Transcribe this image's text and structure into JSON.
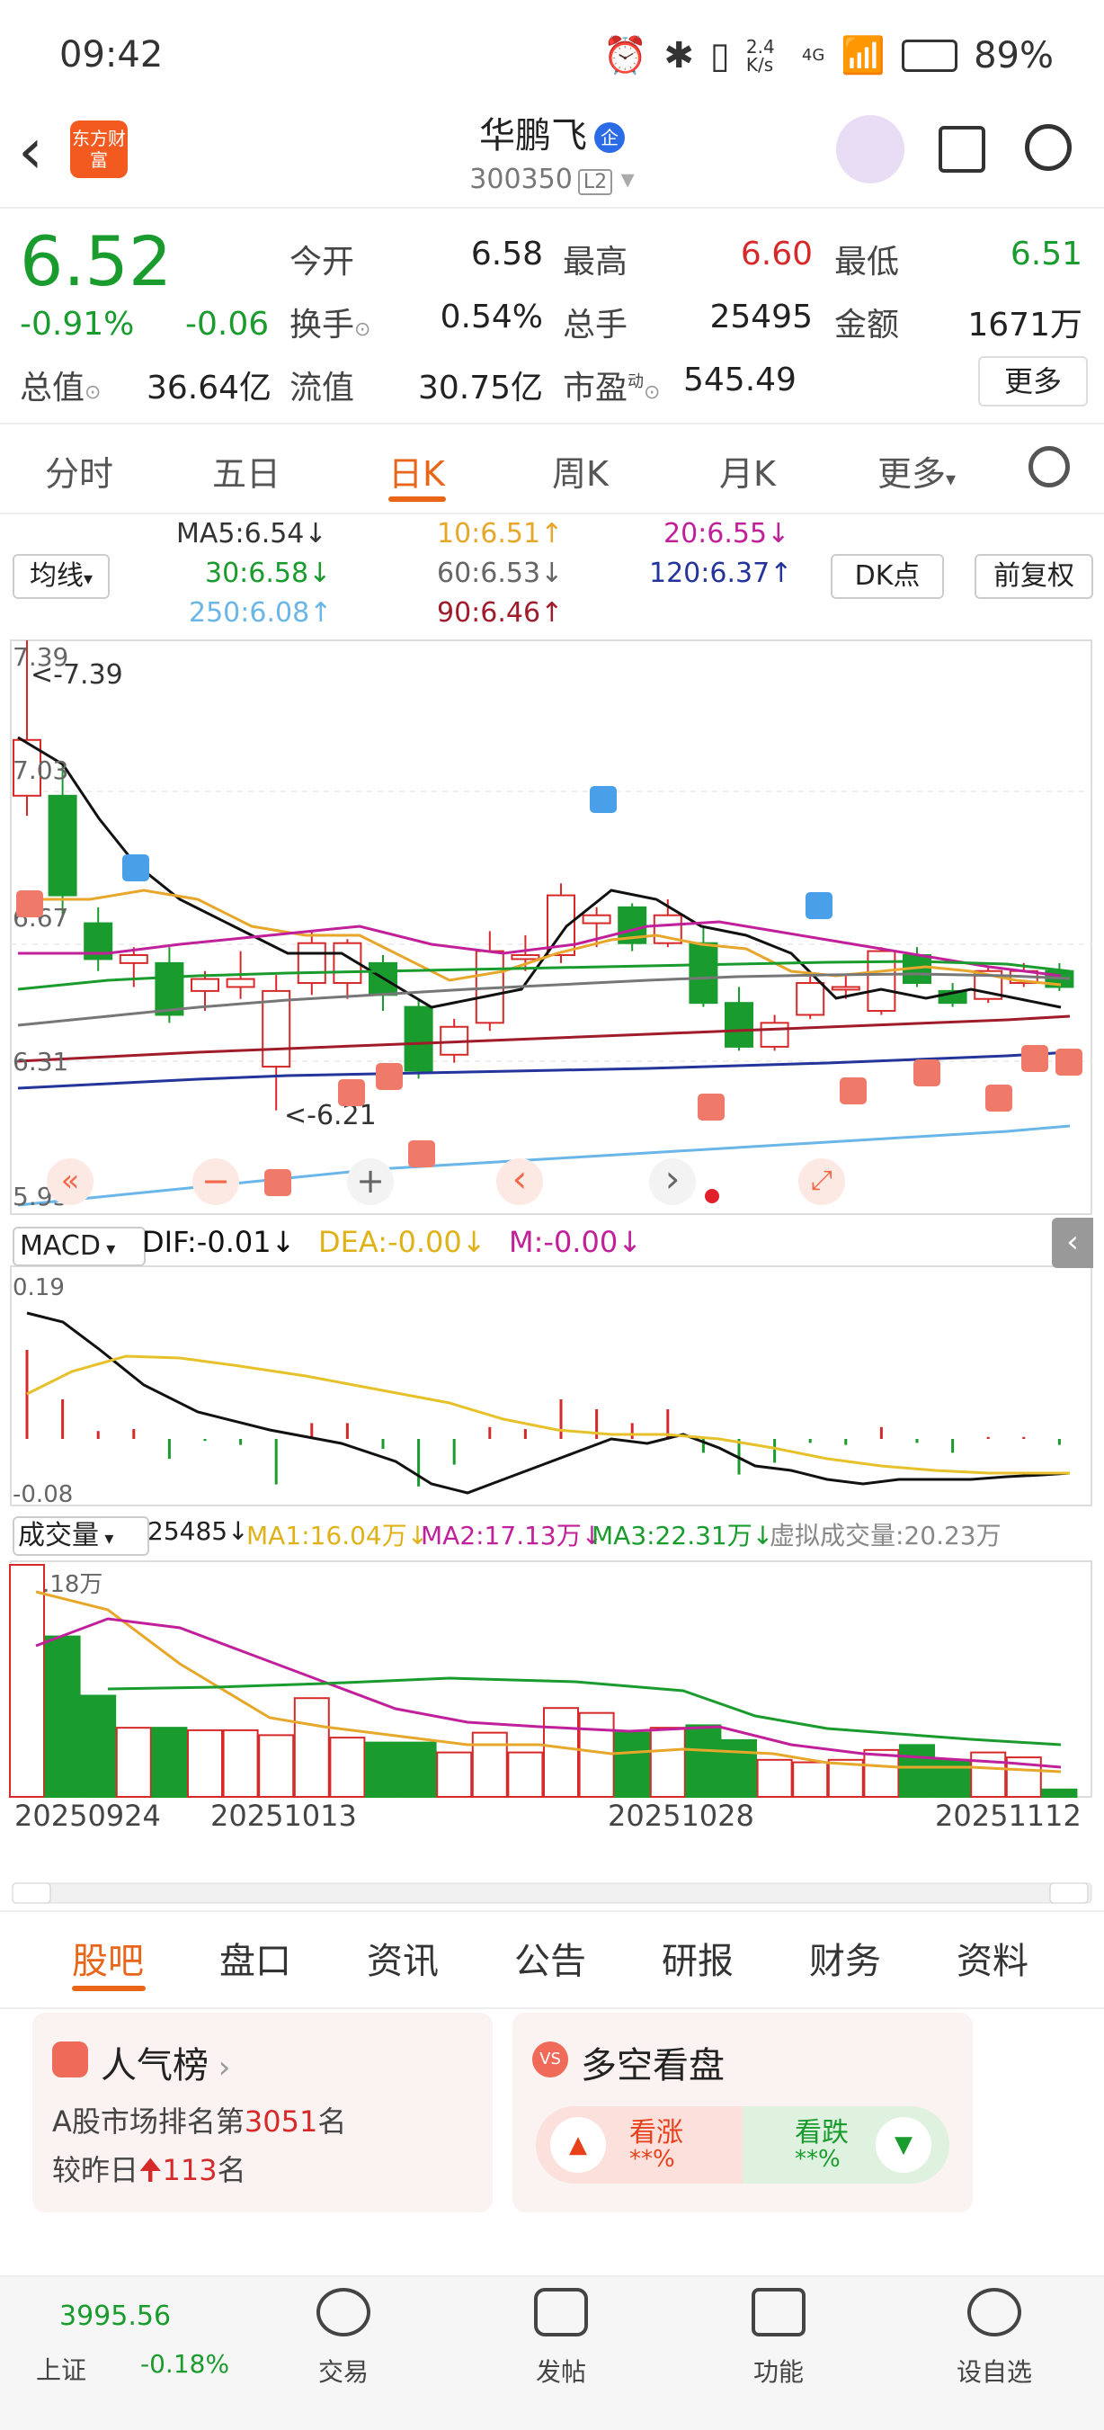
{
  "status": {
    "time": "09:42",
    "net_speed": "2.4 K/s",
    "network": "4G",
    "battery": "89%"
  },
  "header": {
    "logo_text": "东方财富",
    "name": "华鹏飞",
    "badge": "企",
    "code": "300350",
    "level": "L2"
  },
  "quote": {
    "price": "6.52",
    "change_pct": "-0.91%",
    "change": "-0.06",
    "open_label": "今开",
    "open": "6.58",
    "high_label": "最高",
    "high": "6.60",
    "low_label": "最低",
    "low": "6.51",
    "turnover_label": "换手",
    "turnover": "0.54%",
    "volume_label": "总手",
    "volume": "25495",
    "amount_label": "金额",
    "amount": "1671万",
    "mktcap_label": "总值",
    "mktcap": "36.64亿",
    "float_label": "流值",
    "float_cap": "30.75亿",
    "pe_label": "市盈",
    "pe_sup": "动",
    "pe": "545.49",
    "more": "更多"
  },
  "tabs": [
    "分时",
    "五日",
    "日K",
    "周K",
    "月K",
    "更多"
  ],
  "active_tab": "日K",
  "ma": {
    "selector": "均线",
    "dk": "DK点",
    "adjust": "前复权",
    "ma5": "MA5:6.54↓",
    "ma10": "10:6.51↑",
    "ma20": "20:6.55↓",
    "ma30": "30:6.58↓",
    "ma60": "60:6.53↓",
    "ma120": "120:6.37↑",
    "ma250": "250:6.08↑",
    "ma90": "90:6.46↑"
  },
  "chart_labels": {
    "y_top": "7.39",
    "y_mid1": "7.03",
    "y_mid2": "6.67",
    "y_mid3": "6.31",
    "y_bottom": "5.95",
    "max_marker": "<-7.39",
    "min_marker": "<-6.21",
    "macd_select": "MACD",
    "dif": "DIF:-0.01↓",
    "dea": "DEA:-0.00↓",
    "m": "M:-0.00↓",
    "macd_top": "0.19",
    "macd_bottom": "-0.08",
    "vol_select": "成交量",
    "vol_now": "25485↓",
    "vol_ma1": "MA1:16.04万↓",
    "vol_ma2": "MA2:17.13万↓",
    "vol_ma3": "MA3:22.31万↓",
    "vol_virtual": "虚拟成交量:20.23万",
    "vol_top": "94.18万",
    "dates": [
      "20250924",
      "20251013",
      "20251028",
      "20251112"
    ]
  },
  "chart_data": {
    "type": "candlestick",
    "ylim": [
      5.95,
      7.39
    ],
    "candles": [
      {
        "o": 7.14,
        "c": 7.0,
        "h": 7.39,
        "l": 6.95,
        "up": true
      },
      {
        "o": 7.0,
        "c": 6.75,
        "h": 7.08,
        "l": 6.7,
        "up": false
      },
      {
        "o": 6.68,
        "c": 6.59,
        "h": 6.72,
        "l": 6.56,
        "up": false
      },
      {
        "o": 6.58,
        "c": 6.6,
        "h": 6.62,
        "l": 6.52,
        "up": true
      },
      {
        "o": 6.58,
        "c": 6.45,
        "h": 6.62,
        "l": 6.43,
        "up": false
      },
      {
        "o": 6.51,
        "c": 6.54,
        "h": 6.56,
        "l": 6.46,
        "up": true
      },
      {
        "o": 6.54,
        "c": 6.52,
        "h": 6.61,
        "l": 6.49,
        "up": true
      },
      {
        "o": 6.51,
        "c": 6.32,
        "h": 6.55,
        "l": 6.21,
        "up": true
      },
      {
        "o": 6.53,
        "c": 6.63,
        "h": 6.66,
        "l": 6.5,
        "up": true
      },
      {
        "o": 6.53,
        "c": 6.63,
        "h": 6.64,
        "l": 6.49,
        "up": true
      },
      {
        "o": 6.58,
        "c": 6.5,
        "h": 6.6,
        "l": 6.46,
        "up": false
      },
      {
        "o": 6.47,
        "c": 6.31,
        "h": 6.49,
        "l": 6.29,
        "up": false
      },
      {
        "o": 6.35,
        "c": 6.42,
        "h": 6.44,
        "l": 6.33,
        "up": true
      },
      {
        "o": 6.43,
        "c": 6.61,
        "h": 6.66,
        "l": 6.41,
        "up": true
      },
      {
        "o": 6.59,
        "c": 6.6,
        "h": 6.65,
        "l": 6.56,
        "up": true
      },
      {
        "o": 6.6,
        "c": 6.75,
        "h": 6.78,
        "l": 6.58,
        "up": true
      },
      {
        "o": 6.68,
        "c": 6.7,
        "h": 6.72,
        "l": 6.62,
        "up": true
      },
      {
        "o": 6.72,
        "c": 6.63,
        "h": 6.73,
        "l": 6.61,
        "up": false
      },
      {
        "o": 6.63,
        "c": 6.7,
        "h": 6.74,
        "l": 6.62,
        "up": true
      },
      {
        "o": 6.63,
        "c": 6.48,
        "h": 6.67,
        "l": 6.47,
        "up": false
      },
      {
        "o": 6.48,
        "c": 6.37,
        "h": 6.52,
        "l": 6.36,
        "up": false
      },
      {
        "o": 6.37,
        "c": 6.43,
        "h": 6.45,
        "l": 6.36,
        "up": true
      },
      {
        "o": 6.45,
        "c": 6.53,
        "h": 6.55,
        "l": 6.44,
        "up": true
      },
      {
        "o": 6.52,
        "c": 6.52,
        "h": 6.55,
        "l": 6.49,
        "up": true
      },
      {
        "o": 6.46,
        "c": 6.61,
        "h": 6.62,
        "l": 6.45,
        "up": true
      },
      {
        "o": 6.6,
        "c": 6.53,
        "h": 6.62,
        "l": 6.52,
        "up": false
      },
      {
        "o": 6.51,
        "c": 6.48,
        "h": 6.53,
        "l": 6.47,
        "up": false
      },
      {
        "o": 6.49,
        "c": 6.56,
        "h": 6.57,
        "l": 6.48,
        "up": true
      },
      {
        "o": 6.53,
        "c": 6.56,
        "h": 6.58,
        "l": 6.52,
        "up": true
      },
      {
        "o": 6.56,
        "c": 6.52,
        "h": 6.58,
        "l": 6.51,
        "up": false
      }
    ],
    "volume": [
      94,
      65,
      41,
      28,
      28,
      27,
      27,
      25,
      40,
      24,
      22,
      22,
      18,
      26,
      18,
      36,
      34,
      26,
      28,
      29,
      23,
      15,
      14,
      15,
      19,
      21,
      15,
      18,
      16,
      3
    ]
  },
  "controls": {
    "first": "«",
    "zoom_out": "−",
    "zoom_in": "+",
    "prev": "‹",
    "next": "›",
    "fullscreen": "⤢"
  },
  "sections": [
    "股吧",
    "盘口",
    "资讯",
    "公告",
    "研报",
    "财务",
    "资料"
  ],
  "active_section": "股吧",
  "cards": {
    "popularity_title": "人气榜",
    "popularity_rank_pre": "A股市场排名第",
    "popularity_rank": "3051",
    "popularity_rank_post": "名",
    "popularity_change_pre": "较昨日",
    "popularity_change": "113",
    "popularity_change_post": "名",
    "vs_title": "多空看盘",
    "bull_label": "看涨",
    "bull_val": "**%",
    "bear_label": "看跌",
    "bear_val": "**%"
  },
  "bottom": {
    "index_value": "3995.56",
    "index_name": "上证",
    "index_change": "-0.18%",
    "items": [
      "交易",
      "发帖",
      "功能",
      "设自选"
    ]
  }
}
